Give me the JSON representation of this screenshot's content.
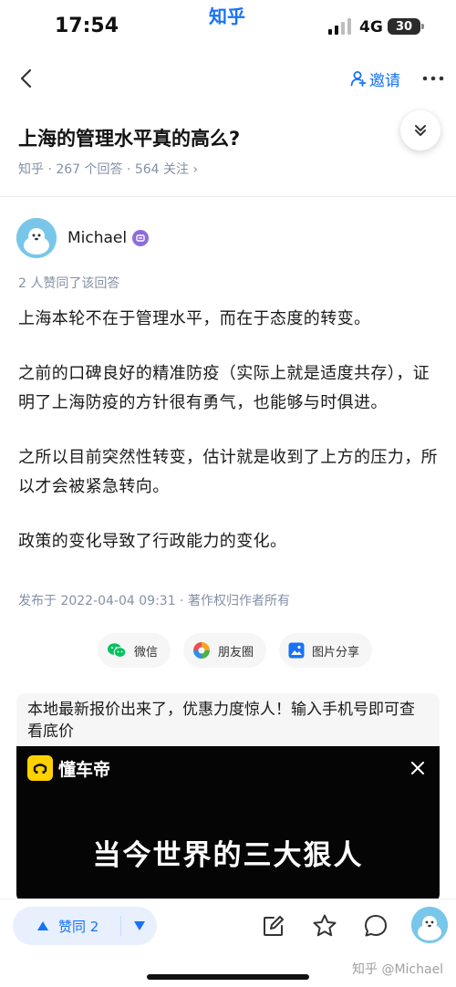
{
  "status_bar": {
    "time": "17:54",
    "app_brand": "知乎",
    "network": "4G",
    "battery": "30"
  },
  "nav": {
    "invite_label": "邀请"
  },
  "question": {
    "title": "上海的管理水平真的高么?",
    "meta": "知乎 · 267 个回答 · 564 关注 ›"
  },
  "author": {
    "name": "Michael"
  },
  "answer": {
    "approval_note": "2 人赞同了该回答",
    "paragraphs": [
      "上海本轮不在于管理水平，而在于态度的转变。",
      "之前的口碑良好的精准防疫（实际上就是适度共存），证明了上海防疫的方针很有勇气，也能够与时俱进。",
      "之所以目前突然性转变，估计就是收到了上方的压力，所以才会被紧急转向。",
      "政策的变化导致了行政能力的变化。"
    ],
    "publish_info": "发布于 2022-04-04 09:31 · 著作权归作者所有"
  },
  "share": {
    "wechat": "微信",
    "moments": "朋友圈",
    "image_share": "图片分享"
  },
  "ad": {
    "text": "本地最新报价出来了，优惠力度惊人！输入手机号即可查看底价",
    "brand": "懂车帝",
    "headline": "当今世界的三大狠人"
  },
  "bottom_bar": {
    "upvote_label": "赞同 2",
    "watermark": "知乎 @Michael"
  },
  "colors": {
    "accent": "#1772f6",
    "meta_gray": "#8590a6"
  }
}
